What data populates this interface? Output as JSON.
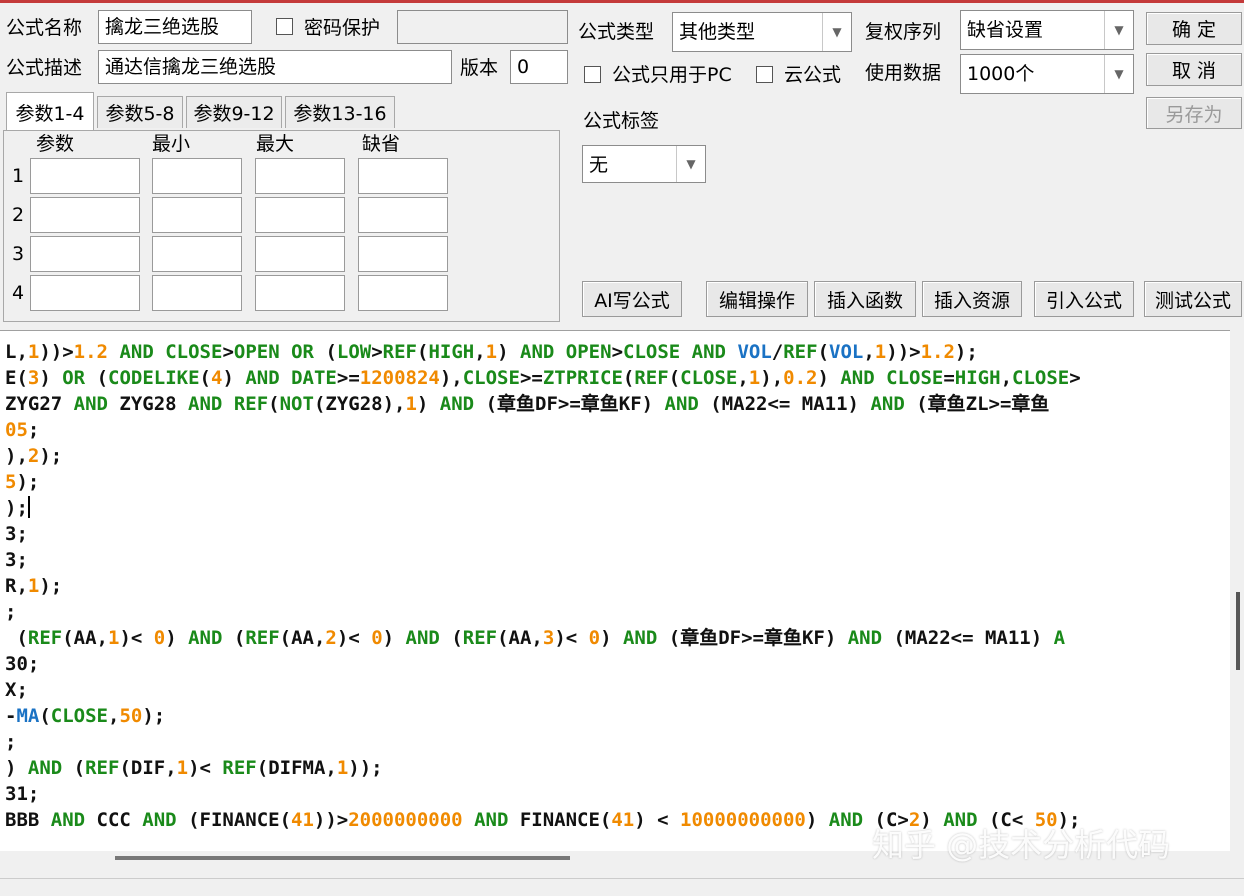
{
  "header": {
    "name_label": "公式名称",
    "name_value": "擒龙三绝选股",
    "password_label": "密码保护",
    "password_value": "",
    "desc_label": "公式描述",
    "desc_value": "通达信擒龙三绝选股",
    "version_label": "版本",
    "version_value": "0",
    "type_label": "公式类型",
    "type_value": "其他类型",
    "rights_label": "复权序列",
    "rights_value": "缺省设置",
    "pc_only_label": "公式只用于PC",
    "cloud_label": "云公式",
    "data_label": "使用数据",
    "data_value": "1000个",
    "tag_label": "公式标签",
    "tag_value": "无"
  },
  "buttons": {
    "ok": "确  定",
    "cancel": "取  消",
    "save_as": "另存为",
    "ai": "AI写公式",
    "edit_ops": "编辑操作",
    "insert_func": "插入函数",
    "insert_res": "插入资源",
    "import": "引入公式",
    "test": "测试公式"
  },
  "params": {
    "tabs": [
      "参数1-4",
      "参数5-8",
      "参数9-12",
      "参数13-16"
    ],
    "active_tab": 0,
    "columns": [
      "参数",
      "最小",
      "最大",
      "缺省"
    ],
    "rows": [
      "1",
      "2",
      "3",
      "4"
    ]
  },
  "editor": {
    "lines": [
      [
        [
          "L,",
          ""
        ],
        [
          "1",
          "n"
        ],
        [
          "))>",
          ""
        ],
        [
          "1.2",
          "n"
        ],
        [
          " ",
          ""
        ],
        [
          "AND",
          "k"
        ],
        [
          " ",
          ""
        ],
        [
          "CLOSE",
          "k"
        ],
        [
          ">",
          ""
        ],
        [
          "OPEN",
          "k"
        ],
        [
          " ",
          ""
        ],
        [
          "OR",
          "k"
        ],
        [
          " (",
          ""
        ],
        [
          "LOW",
          "k"
        ],
        [
          ">",
          ""
        ],
        [
          "REF",
          "k"
        ],
        [
          "(",
          ""
        ],
        [
          "HIGH",
          "k"
        ],
        [
          ",",
          ""
        ],
        [
          "1",
          "n"
        ],
        [
          ") ",
          ""
        ],
        [
          "AND",
          "k"
        ],
        [
          " ",
          ""
        ],
        [
          "OPEN",
          "k"
        ],
        [
          ">",
          ""
        ],
        [
          "CLOSE",
          "k"
        ],
        [
          " ",
          ""
        ],
        [
          "AND",
          "k"
        ],
        [
          " ",
          ""
        ],
        [
          "VOL",
          "f"
        ],
        [
          "/",
          ""
        ],
        [
          "REF",
          "k"
        ],
        [
          "(",
          ""
        ],
        [
          "VOL",
          "f"
        ],
        [
          ",",
          ""
        ],
        [
          "1",
          "n"
        ],
        [
          "))>",
          ""
        ],
        [
          "1.2",
          "n"
        ],
        [
          ");",
          ""
        ]
      ],
      [
        [
          "E(",
          ""
        ],
        [
          "3",
          "n"
        ],
        [
          ") ",
          ""
        ],
        [
          "OR",
          "k"
        ],
        [
          " (",
          ""
        ],
        [
          "CODELIKE",
          "k"
        ],
        [
          "(",
          ""
        ],
        [
          "4",
          "n"
        ],
        [
          ") ",
          ""
        ],
        [
          "AND",
          "k"
        ],
        [
          " ",
          ""
        ],
        [
          "DATE",
          "k"
        ],
        [
          ">=",
          ""
        ],
        [
          "1200824",
          "n"
        ],
        [
          "),",
          ""
        ],
        [
          "CLOSE",
          "k"
        ],
        [
          ">=",
          ""
        ],
        [
          "ZTPRICE",
          "k"
        ],
        [
          "(",
          ""
        ],
        [
          "REF",
          "k"
        ],
        [
          "(",
          ""
        ],
        [
          "CLOSE",
          "k"
        ],
        [
          ",",
          ""
        ],
        [
          "1",
          "n"
        ],
        [
          "),",
          ""
        ],
        [
          "0.2",
          "n"
        ],
        [
          ") ",
          ""
        ],
        [
          "AND",
          "k"
        ],
        [
          " ",
          ""
        ],
        [
          "CLOSE",
          "k"
        ],
        [
          "=",
          ""
        ],
        [
          "HIGH",
          "k"
        ],
        [
          ",",
          ""
        ],
        [
          "CLOSE",
          "k"
        ],
        [
          ">",
          ""
        ]
      ],
      [
        [
          "ZYG27 ",
          ""
        ],
        [
          "AND",
          "k"
        ],
        [
          " ZYG28 ",
          ""
        ],
        [
          "AND",
          "k"
        ],
        [
          " ",
          ""
        ],
        [
          "REF",
          "k"
        ],
        [
          "(",
          ""
        ],
        [
          "NOT",
          "k"
        ],
        [
          "(ZYG28),",
          ""
        ],
        [
          "1",
          "n"
        ],
        [
          ") ",
          ""
        ],
        [
          "AND",
          "k"
        ],
        [
          " (章鱼DF>=章鱼KF) ",
          ""
        ],
        [
          "AND",
          "k"
        ],
        [
          " (MA22<= MA11) ",
          ""
        ],
        [
          "AND",
          "k"
        ],
        [
          " (章鱼ZL>=章鱼",
          ""
        ]
      ],
      [
        [
          "05",
          "n"
        ],
        [
          ";",
          ""
        ]
      ],
      [
        [
          "),",
          ""
        ],
        [
          "2",
          "n"
        ],
        [
          ");",
          ""
        ]
      ],
      [
        [
          "5",
          "n"
        ],
        [
          ");",
          ""
        ]
      ],
      [
        [
          ");",
          ""
        ],
        [
          "",
          "cursor"
        ]
      ],
      [
        [
          "3;",
          ""
        ]
      ],
      [
        [
          "3;",
          ""
        ]
      ],
      [
        [
          "R,",
          ""
        ],
        [
          "1",
          "n"
        ],
        [
          ");",
          ""
        ]
      ],
      [
        [
          ";",
          ""
        ]
      ],
      [
        [
          " (",
          ""
        ],
        [
          "REF",
          "k"
        ],
        [
          "(AA,",
          ""
        ],
        [
          "1",
          "n"
        ],
        [
          ")< ",
          ""
        ],
        [
          "0",
          "n"
        ],
        [
          ") ",
          ""
        ],
        [
          "AND",
          "k"
        ],
        [
          " (",
          ""
        ],
        [
          "REF",
          "k"
        ],
        [
          "(AA,",
          ""
        ],
        [
          "2",
          "n"
        ],
        [
          ")< ",
          ""
        ],
        [
          "0",
          "n"
        ],
        [
          ") ",
          ""
        ],
        [
          "AND",
          "k"
        ],
        [
          " (",
          ""
        ],
        [
          "REF",
          "k"
        ],
        [
          "(AA,",
          ""
        ],
        [
          "3",
          "n"
        ],
        [
          ")< ",
          ""
        ],
        [
          "0",
          "n"
        ],
        [
          ") ",
          ""
        ],
        [
          "AND",
          "k"
        ],
        [
          " (章鱼DF>=章鱼KF) ",
          ""
        ],
        [
          "AND",
          "k"
        ],
        [
          " (MA22<= MA11) ",
          ""
        ],
        [
          "A",
          "k"
        ]
      ],
      [
        [
          "30",
          ""
        ],
        [
          ";",
          ""
        ]
      ],
      [
        [
          "X;",
          ""
        ]
      ],
      [
        [
          "-",
          ""
        ],
        [
          "MA",
          "f"
        ],
        [
          "(",
          ""
        ],
        [
          "CLOSE",
          "k"
        ],
        [
          ",",
          ""
        ],
        [
          "50",
          "n"
        ],
        [
          ");",
          ""
        ]
      ],
      [
        [
          ";",
          ""
        ]
      ],
      [
        [
          ") ",
          ""
        ],
        [
          "AND",
          "k"
        ],
        [
          " (",
          ""
        ],
        [
          "REF",
          "k"
        ],
        [
          "(DIF,",
          ""
        ],
        [
          "1",
          "n"
        ],
        [
          ")< ",
          ""
        ],
        [
          "REF",
          "k"
        ],
        [
          "(DIFMA,",
          ""
        ],
        [
          "1",
          "n"
        ],
        [
          "));",
          ""
        ]
      ],
      [
        [
          "31;",
          ""
        ]
      ],
      [
        [
          "BBB ",
          ""
        ],
        [
          "AND",
          "k"
        ],
        [
          " CCC ",
          ""
        ],
        [
          "AND",
          "k"
        ],
        [
          " (FINANCE(",
          ""
        ],
        [
          "41",
          "n"
        ],
        [
          "))>",
          ""
        ],
        [
          "2000000000",
          "n"
        ],
        [
          " ",
          ""
        ],
        [
          "AND",
          "k"
        ],
        [
          " FINANCE(",
          ""
        ],
        [
          "41",
          "n"
        ],
        [
          ") < ",
          ""
        ],
        [
          "10000000000",
          "n"
        ],
        [
          ") ",
          ""
        ],
        [
          "AND",
          "k"
        ],
        [
          " (C>",
          ""
        ],
        [
          "2",
          "n"
        ],
        [
          ") ",
          ""
        ],
        [
          "AND",
          "k"
        ],
        [
          " (C< ",
          ""
        ],
        [
          "50",
          "n"
        ],
        [
          ");",
          ""
        ]
      ]
    ]
  },
  "watermark": "知乎 @技术分析代码"
}
